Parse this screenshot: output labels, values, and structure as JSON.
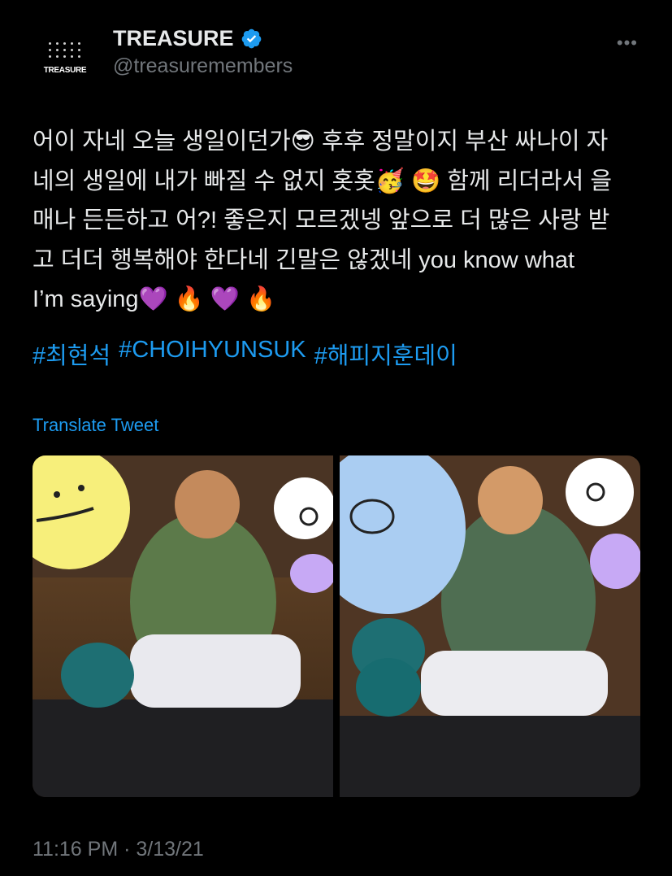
{
  "account": {
    "avatar_text": "TREASURE",
    "display_name": "TREASURE",
    "handle": "@treasuremembers"
  },
  "tweet": {
    "text": "어이 자네 오늘 생일이던가😎 후후 정말이지 부산 싸나이 자\n네의 생일에 내가 빠질 수 없지 홋홋🥳 🤩 함께 리더라서 을\n매나 든든하고 어?! 좋은지 모르겠넹 앞으로 더 많은 사랑 받\n고 더더 행복해야 한다네 긴말은 않겠네 you know what\nI’m saying💜 🔥 💜 🔥",
    "hashtags": [
      "#최현석",
      "#CHOIHYUNSUK",
      "#해피지훈데이"
    ],
    "translate_label": "Translate Tweet",
    "timestamp": "11:16 PM · 3/13/21"
  },
  "icons": {
    "verified": "verified-badge-icon",
    "more": "more-icon"
  },
  "colors": {
    "background": "#000000",
    "link": "#1d9bf0",
    "secondary_text": "#71767b",
    "primary_text": "#e7e9ea"
  }
}
